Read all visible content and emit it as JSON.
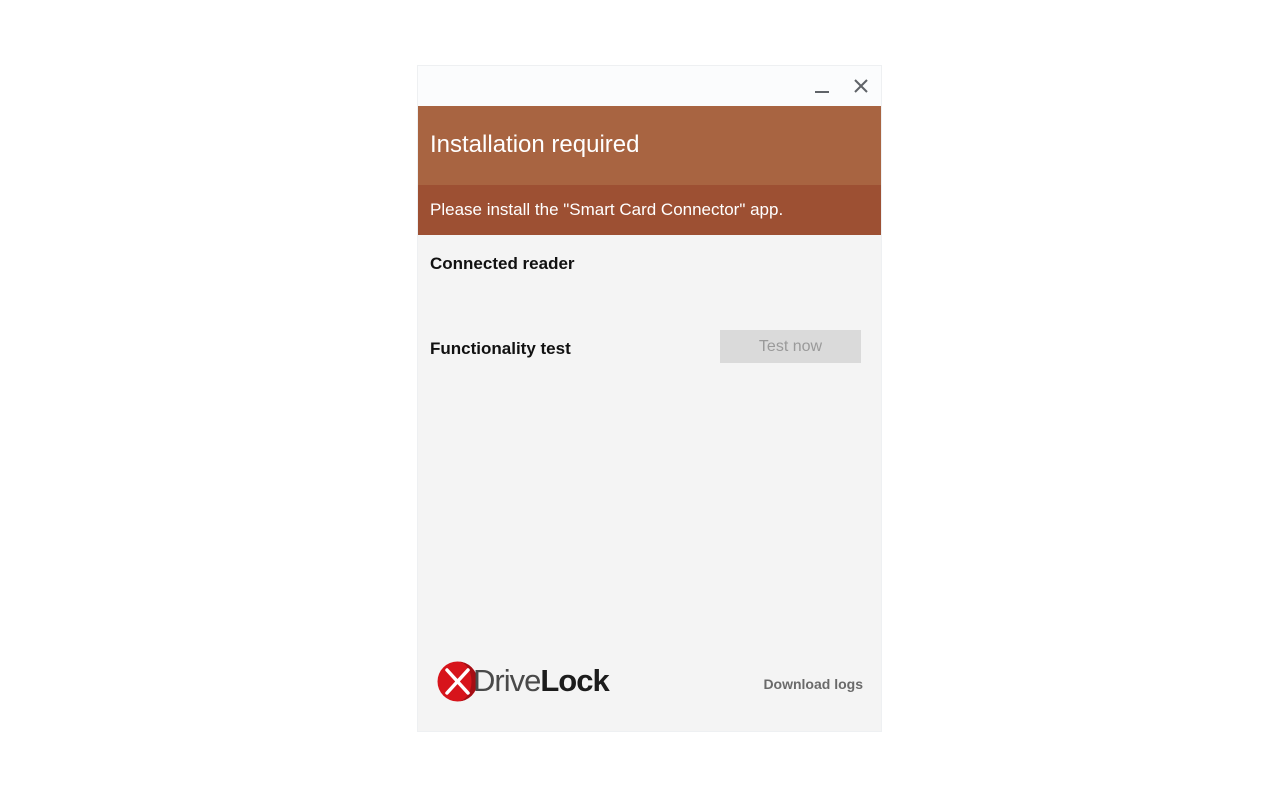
{
  "titlebar": {
    "minimize_icon": "minimize-icon",
    "close_icon": "close-icon"
  },
  "header": {
    "title": "Installation required",
    "background_color": "#a86441"
  },
  "notice": {
    "text": "Please install the \"Smart Card Connector\" app.",
    "background_color": "#9d5033"
  },
  "sections": {
    "connected_reader_label": "Connected reader",
    "functionality_test_label": "Functionality test",
    "test_button_label": "Test now",
    "test_button_enabled": false
  },
  "footer": {
    "logo": {
      "text_light": "Drive",
      "text_bold": "Lock",
      "mark_color": "#d7141b"
    },
    "download_logs_label": "Download logs"
  }
}
